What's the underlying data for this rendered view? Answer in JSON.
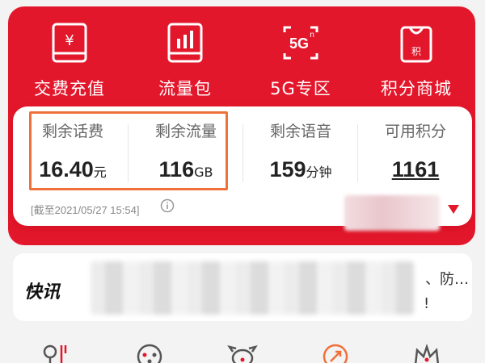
{
  "shortcuts": [
    {
      "label": "交费充值",
      "icon": "yen-card-icon"
    },
    {
      "label": "流量包",
      "icon": "data-bars-icon"
    },
    {
      "label": "5G专区",
      "icon": "5g-icon",
      "icon_text": "5G",
      "icon_sup": "n"
    },
    {
      "label": "积分商城",
      "icon": "shopping-bag-icon",
      "icon_text": "积"
    }
  ],
  "shortcut_icon_yen": "¥",
  "stats": [
    {
      "title": "剩余话费",
      "value": "16.40",
      "unit": "元"
    },
    {
      "title": "剩余流量",
      "value": "116",
      "unit": "GB"
    },
    {
      "title": "剩余语音",
      "value": "159",
      "unit": "分钟"
    },
    {
      "title": "可用积分",
      "value": "1161",
      "unit": ""
    }
  ],
  "as_of": "[截至2021/05/27 15:54]",
  "news": {
    "logo": "快讯",
    "tail_1": "、防…",
    "tail_2": "!"
  },
  "colors": {
    "brand_red": "#e3172b",
    "highlight_orange": "#f0703a"
  }
}
